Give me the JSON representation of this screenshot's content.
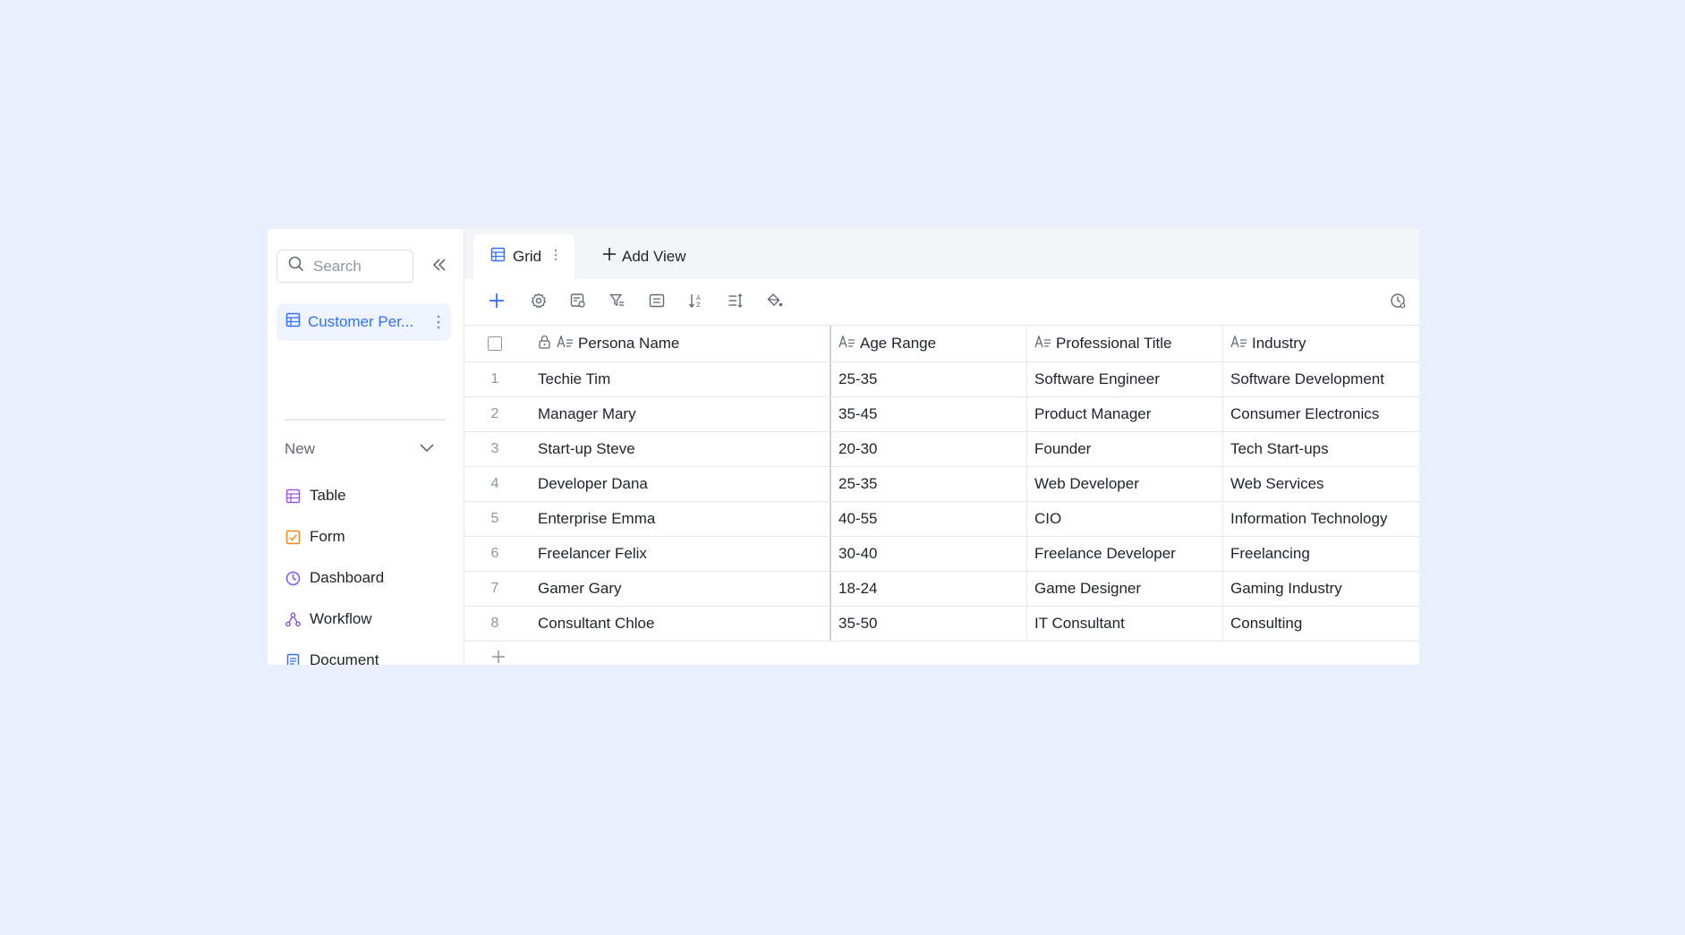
{
  "sidebar": {
    "search_placeholder": "Search",
    "active_item": "Customer Per...",
    "new_label": "New",
    "create_items": [
      {
        "label": "Table",
        "icon": "table-icon",
        "color": "#9b59d9"
      },
      {
        "label": "Form",
        "icon": "form-icon",
        "color": "#f5871f"
      },
      {
        "label": "Dashboard",
        "icon": "dashboard-icon",
        "color": "#7a5cf0"
      },
      {
        "label": "Workflow",
        "icon": "workflow-icon",
        "color": "#8a4fd6"
      },
      {
        "label": "Document",
        "icon": "document-icon",
        "color": "#3370ff"
      }
    ]
  },
  "tabs": {
    "grid_label": "Grid",
    "add_view_label": "Add View"
  },
  "table": {
    "columns": [
      "Persona Name",
      "Age Range",
      "Professional Title",
      "Industry"
    ],
    "rows": [
      {
        "idx": "1",
        "name": "Techie Tim",
        "age": "25-35",
        "title": "Software Engineer",
        "industry": "Software Development"
      },
      {
        "idx": "2",
        "name": "Manager Mary",
        "age": "35-45",
        "title": "Product Manager",
        "industry": "Consumer Electronics"
      },
      {
        "idx": "3",
        "name": "Start-up Steve",
        "age": "20-30",
        "title": "Founder",
        "industry": "Tech Start-ups"
      },
      {
        "idx": "4",
        "name": "Developer Dana",
        "age": "25-35",
        "title": "Web Developer",
        "industry": "Web Services"
      },
      {
        "idx": "5",
        "name": "Enterprise Emma",
        "age": "40-55",
        "title": "CIO",
        "industry": "Information Technology"
      },
      {
        "idx": "6",
        "name": "Freelancer Felix",
        "age": "30-40",
        "title": "Freelance Developer",
        "industry": "Freelancing"
      },
      {
        "idx": "7",
        "name": "Gamer Gary",
        "age": "18-24",
        "title": "Game Designer",
        "industry": "Gaming Industry"
      },
      {
        "idx": "8",
        "name": "Consultant Chloe",
        "age": "35-50",
        "title": "IT Consultant",
        "industry": "Consulting"
      }
    ]
  },
  "colors": {
    "accent": "#3370ff",
    "background": "#e9effd"
  }
}
